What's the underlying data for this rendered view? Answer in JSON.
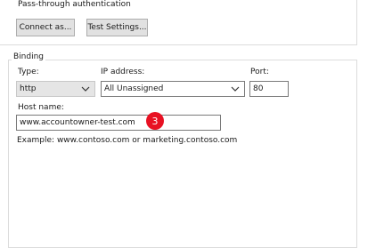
{
  "auth": {
    "label": "Pass-through authentication",
    "connect_as_label": "Connect as...",
    "test_settings_label": "Test Settings..."
  },
  "binding": {
    "title": "Binding",
    "type_label": "Type:",
    "type_value": "http",
    "ip_label": "IP address:",
    "ip_value": "All Unassigned",
    "port_label": "Port:",
    "port_value": "80",
    "host_label": "Host name:",
    "host_value": "www.accountowner-test.com",
    "example_text": "Example: www.contoso.com or marketing.contoso.com"
  },
  "annotation": {
    "step_number": "3",
    "color": "#e81123"
  }
}
